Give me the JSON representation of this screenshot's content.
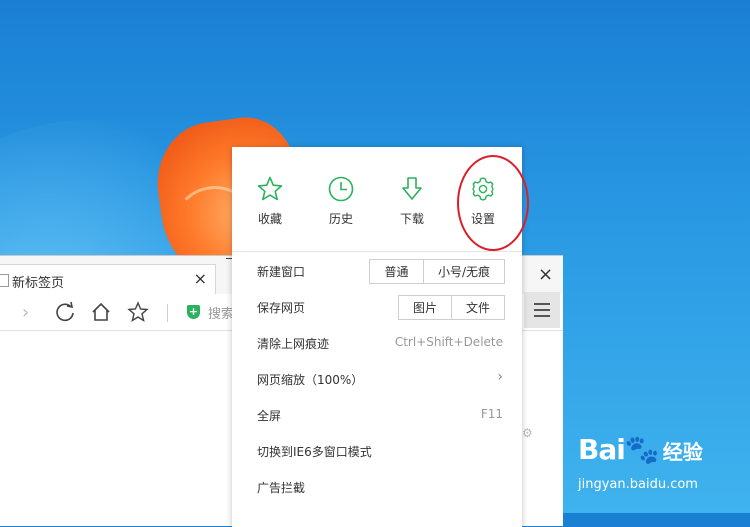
{
  "browser": {
    "tab_title": "新标签页",
    "tab_close": "×",
    "window_close": "×",
    "search_label": "搜索"
  },
  "menu": {
    "quick_actions": [
      {
        "label": "收藏",
        "icon": "star-icon"
      },
      {
        "label": "历史",
        "icon": "clock-icon"
      },
      {
        "label": "下载",
        "icon": "download-arrow-icon"
      },
      {
        "label": "设置",
        "icon": "gear-icon"
      }
    ],
    "items": [
      {
        "label": "新建窗口",
        "segments": [
          "普通",
          "小号/无痕"
        ]
      },
      {
        "label": "保存网页",
        "segments": [
          "图片",
          "文件"
        ]
      },
      {
        "label": "清除上网痕迹",
        "shortcut": "Ctrl+Shift+Delete"
      },
      {
        "label": "网页缩放（100%）",
        "submenu": "›"
      },
      {
        "label": "全屏",
        "shortcut": "F11"
      },
      {
        "label": "切换到IE6多窗口模式"
      },
      {
        "label": "广告拦截"
      }
    ]
  },
  "watermark": {
    "logo": "Bai",
    "logo_tail": "经验",
    "url": "jingyan.baidu.com"
  },
  "colors": {
    "accent_green": "#2bb25c",
    "highlight_red": "#d9202a"
  }
}
